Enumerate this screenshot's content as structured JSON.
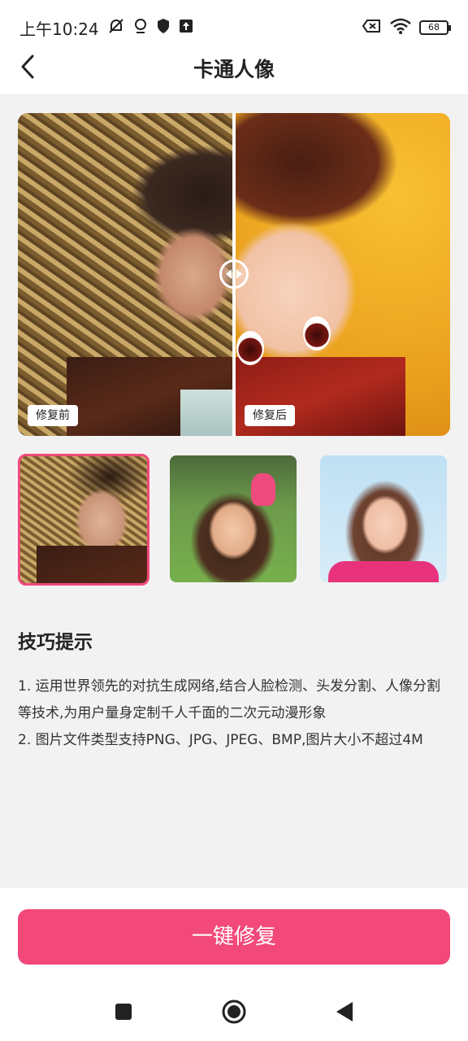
{
  "status_bar": {
    "time": "上午10:24",
    "battery": "68",
    "icons": [
      "mute-alarm-icon",
      "shield-icon",
      "vpn-icon",
      "upload-icon",
      "sim-off-icon",
      "wifi-icon",
      "battery-icon"
    ]
  },
  "header": {
    "title": "卡通人像",
    "back_icon": "chevron-left-icon"
  },
  "compare": {
    "before_label": "修复前",
    "after_label": "修复后",
    "handle_icon": "compare-slider-icon"
  },
  "thumbnails": [
    {
      "name": "thumb-woman-straw-hat",
      "selected": true
    },
    {
      "name": "thumb-girl-pink-bow",
      "selected": false
    },
    {
      "name": "thumb-woman-smiling",
      "selected": false
    }
  ],
  "tips": {
    "title": "技巧提示",
    "items": [
      "1. 运用世界领先的对抗生成网络,结合人脸检测、头发分割、人像分割等技术,为用户量身定制千人千面的二次元动漫形象",
      "2. 图片文件类型支持PNG、JPG、JPEG、BMP,图片大小不超过4M"
    ]
  },
  "action": {
    "button_label": "一键修复"
  },
  "colors": {
    "accent": "#f2497a",
    "background": "#f2f2f2"
  },
  "nav_bar": {
    "icons": [
      "recent-apps-icon",
      "home-icon",
      "back-icon"
    ]
  }
}
